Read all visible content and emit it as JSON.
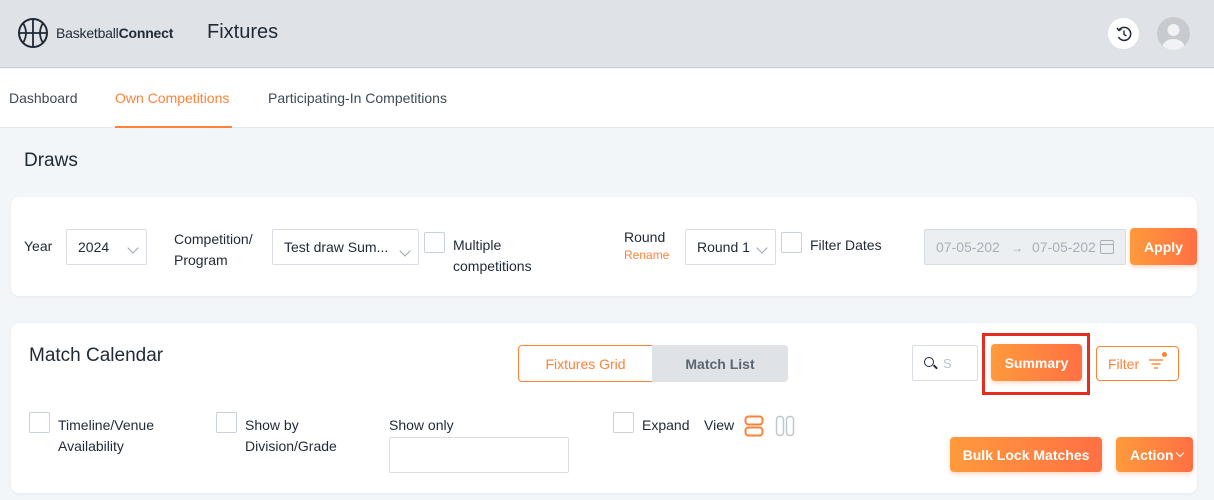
{
  "app": {
    "brand_light": "Basketball",
    "brand_bold": "Connect",
    "page_title": "Fixtures"
  },
  "nav": {
    "items": [
      {
        "label": "Dashboard",
        "active": false
      },
      {
        "label": "Own Competitions",
        "active": true
      },
      {
        "label": "Participating-In Competitions",
        "active": false
      }
    ]
  },
  "section_title": "Draws",
  "filters": {
    "year_label": "Year",
    "year_value": "2024",
    "competition_label_1": "Competition/",
    "competition_label_2": "Program",
    "competition_value": "Test draw Sum...",
    "multiple_label_1": "Multiple",
    "multiple_label_2": "competitions",
    "round_label": "Round",
    "rename_link": "Rename",
    "round_value": "Round 1",
    "filter_dates_label": "Filter Dates",
    "date_from": "07-05-202",
    "date_to": "07-05-202",
    "date_arrow": "→",
    "apply_label": "Apply"
  },
  "calendar": {
    "title": "Match Calendar",
    "tab_fixtures_grid": "Fixtures Grid",
    "tab_match_list": "Match List",
    "search_placeholder": "S",
    "summary_label": "Summary",
    "filter_label": "Filter",
    "timeline_label_1": "Timeline/Venue",
    "timeline_label_2": "Availability",
    "division_label_1": "Show by",
    "division_label_2": "Division/Grade",
    "show_only_label": "Show only",
    "expand_label": "Expand",
    "view_label": "View",
    "bulk_lock_label": "Bulk Lock Matches",
    "action_label": "Action"
  },
  "colors": {
    "accent": "#ff8237",
    "highlight": "#e42d1e",
    "topbar": "#dfe3e7"
  },
  "icons": {
    "logo": "basketball-icon",
    "sync": "sync-icon",
    "avatar": "user-avatar-icon",
    "search": "search-icon",
    "filter": "filter-lines-icon",
    "view_rows": "view-rows-icon",
    "view_columns": "view-columns-icon",
    "calendar": "calendar-icon"
  }
}
